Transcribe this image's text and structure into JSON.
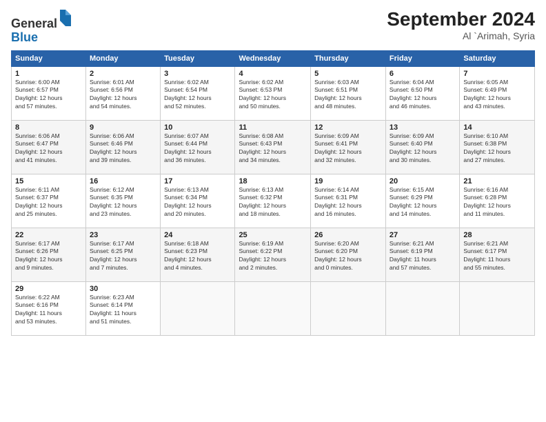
{
  "header": {
    "logo_general": "General",
    "logo_blue": "Blue",
    "month_title": "September 2024",
    "location": "Al `Arimah, Syria"
  },
  "days_of_week": [
    "Sunday",
    "Monday",
    "Tuesday",
    "Wednesday",
    "Thursday",
    "Friday",
    "Saturday"
  ],
  "weeks": [
    [
      {
        "day": "1",
        "info": "Sunrise: 6:00 AM\nSunset: 6:57 PM\nDaylight: 12 hours\nand 57 minutes."
      },
      {
        "day": "2",
        "info": "Sunrise: 6:01 AM\nSunset: 6:56 PM\nDaylight: 12 hours\nand 54 minutes."
      },
      {
        "day": "3",
        "info": "Sunrise: 6:02 AM\nSunset: 6:54 PM\nDaylight: 12 hours\nand 52 minutes."
      },
      {
        "day": "4",
        "info": "Sunrise: 6:02 AM\nSunset: 6:53 PM\nDaylight: 12 hours\nand 50 minutes."
      },
      {
        "day": "5",
        "info": "Sunrise: 6:03 AM\nSunset: 6:51 PM\nDaylight: 12 hours\nand 48 minutes."
      },
      {
        "day": "6",
        "info": "Sunrise: 6:04 AM\nSunset: 6:50 PM\nDaylight: 12 hours\nand 46 minutes."
      },
      {
        "day": "7",
        "info": "Sunrise: 6:05 AM\nSunset: 6:49 PM\nDaylight: 12 hours\nand 43 minutes."
      }
    ],
    [
      {
        "day": "8",
        "info": "Sunrise: 6:06 AM\nSunset: 6:47 PM\nDaylight: 12 hours\nand 41 minutes."
      },
      {
        "day": "9",
        "info": "Sunrise: 6:06 AM\nSunset: 6:46 PM\nDaylight: 12 hours\nand 39 minutes."
      },
      {
        "day": "10",
        "info": "Sunrise: 6:07 AM\nSunset: 6:44 PM\nDaylight: 12 hours\nand 36 minutes."
      },
      {
        "day": "11",
        "info": "Sunrise: 6:08 AM\nSunset: 6:43 PM\nDaylight: 12 hours\nand 34 minutes."
      },
      {
        "day": "12",
        "info": "Sunrise: 6:09 AM\nSunset: 6:41 PM\nDaylight: 12 hours\nand 32 minutes."
      },
      {
        "day": "13",
        "info": "Sunrise: 6:09 AM\nSunset: 6:40 PM\nDaylight: 12 hours\nand 30 minutes."
      },
      {
        "day": "14",
        "info": "Sunrise: 6:10 AM\nSunset: 6:38 PM\nDaylight: 12 hours\nand 27 minutes."
      }
    ],
    [
      {
        "day": "15",
        "info": "Sunrise: 6:11 AM\nSunset: 6:37 PM\nDaylight: 12 hours\nand 25 minutes."
      },
      {
        "day": "16",
        "info": "Sunrise: 6:12 AM\nSunset: 6:35 PM\nDaylight: 12 hours\nand 23 minutes."
      },
      {
        "day": "17",
        "info": "Sunrise: 6:13 AM\nSunset: 6:34 PM\nDaylight: 12 hours\nand 20 minutes."
      },
      {
        "day": "18",
        "info": "Sunrise: 6:13 AM\nSunset: 6:32 PM\nDaylight: 12 hours\nand 18 minutes."
      },
      {
        "day": "19",
        "info": "Sunrise: 6:14 AM\nSunset: 6:31 PM\nDaylight: 12 hours\nand 16 minutes."
      },
      {
        "day": "20",
        "info": "Sunrise: 6:15 AM\nSunset: 6:29 PM\nDaylight: 12 hours\nand 14 minutes."
      },
      {
        "day": "21",
        "info": "Sunrise: 6:16 AM\nSunset: 6:28 PM\nDaylight: 12 hours\nand 11 minutes."
      }
    ],
    [
      {
        "day": "22",
        "info": "Sunrise: 6:17 AM\nSunset: 6:26 PM\nDaylight: 12 hours\nand 9 minutes."
      },
      {
        "day": "23",
        "info": "Sunrise: 6:17 AM\nSunset: 6:25 PM\nDaylight: 12 hours\nand 7 minutes."
      },
      {
        "day": "24",
        "info": "Sunrise: 6:18 AM\nSunset: 6:23 PM\nDaylight: 12 hours\nand 4 minutes."
      },
      {
        "day": "25",
        "info": "Sunrise: 6:19 AM\nSunset: 6:22 PM\nDaylight: 12 hours\nand 2 minutes."
      },
      {
        "day": "26",
        "info": "Sunrise: 6:20 AM\nSunset: 6:20 PM\nDaylight: 12 hours\nand 0 minutes."
      },
      {
        "day": "27",
        "info": "Sunrise: 6:21 AM\nSunset: 6:19 PM\nDaylight: 11 hours\nand 57 minutes."
      },
      {
        "day": "28",
        "info": "Sunrise: 6:21 AM\nSunset: 6:17 PM\nDaylight: 11 hours\nand 55 minutes."
      }
    ],
    [
      {
        "day": "29",
        "info": "Sunrise: 6:22 AM\nSunset: 6:16 PM\nDaylight: 11 hours\nand 53 minutes."
      },
      {
        "day": "30",
        "info": "Sunrise: 6:23 AM\nSunset: 6:14 PM\nDaylight: 11 hours\nand 51 minutes."
      },
      {
        "day": "",
        "info": ""
      },
      {
        "day": "",
        "info": ""
      },
      {
        "day": "",
        "info": ""
      },
      {
        "day": "",
        "info": ""
      },
      {
        "day": "",
        "info": ""
      }
    ]
  ]
}
